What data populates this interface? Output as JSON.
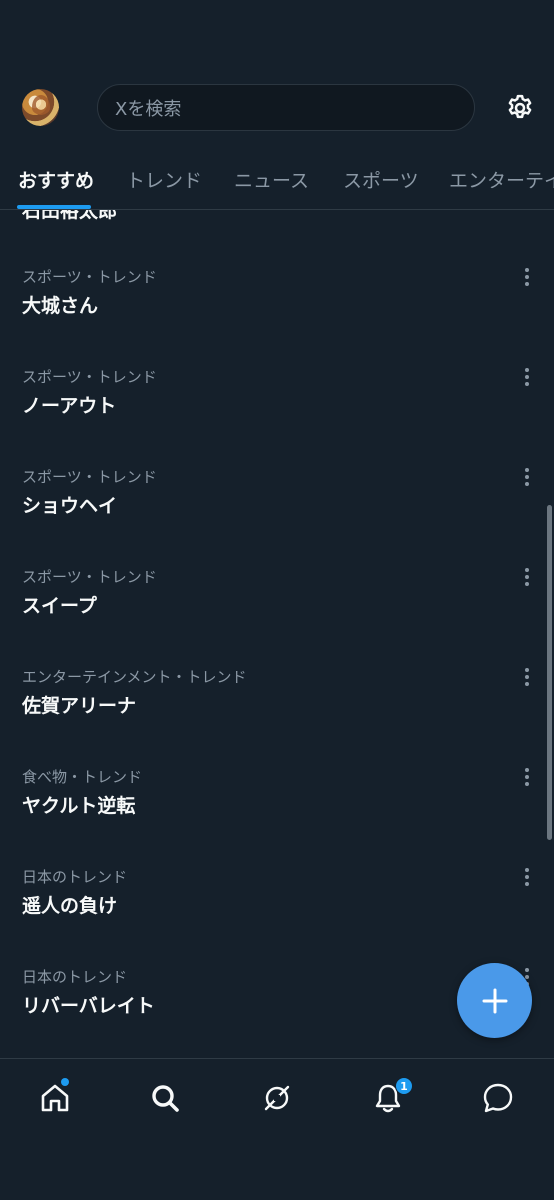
{
  "header": {
    "search_placeholder": "Xを検索"
  },
  "tabs": [
    {
      "label": "おすすめ",
      "active": true
    },
    {
      "label": "トレンド",
      "active": false
    },
    {
      "label": "ニュース",
      "active": false
    },
    {
      "label": "スポーツ",
      "active": false
    },
    {
      "label": "エンターテイ",
      "active": false
    }
  ],
  "peek_item": "石田裕太郎",
  "trends": [
    {
      "category": "スポーツ・トレンド",
      "name": "大城さん"
    },
    {
      "category": "スポーツ・トレンド",
      "name": "ノーアウト"
    },
    {
      "category": "スポーツ・トレンド",
      "name": "ショウヘイ"
    },
    {
      "category": "スポーツ・トレンド",
      "name": "スイープ"
    },
    {
      "category": "エンターテインメント・トレンド",
      "name": "佐賀アリーナ"
    },
    {
      "category": "食べ物・トレンド",
      "name": "ヤクルト逆転"
    },
    {
      "category": "日本のトレンド",
      "name": "遥人の負け"
    },
    {
      "category": "日本のトレンド",
      "name": "リバーバレイト"
    }
  ],
  "nav": {
    "notifications_badge": "1",
    "icons": [
      "home-icon",
      "search-icon",
      "grok-icon",
      "bell-icon",
      "messages-icon"
    ]
  },
  "colors": {
    "background": "#15202b",
    "accent": "#1d9bf0",
    "fab": "#4a99e9",
    "secondary_text": "#8b98a5"
  }
}
